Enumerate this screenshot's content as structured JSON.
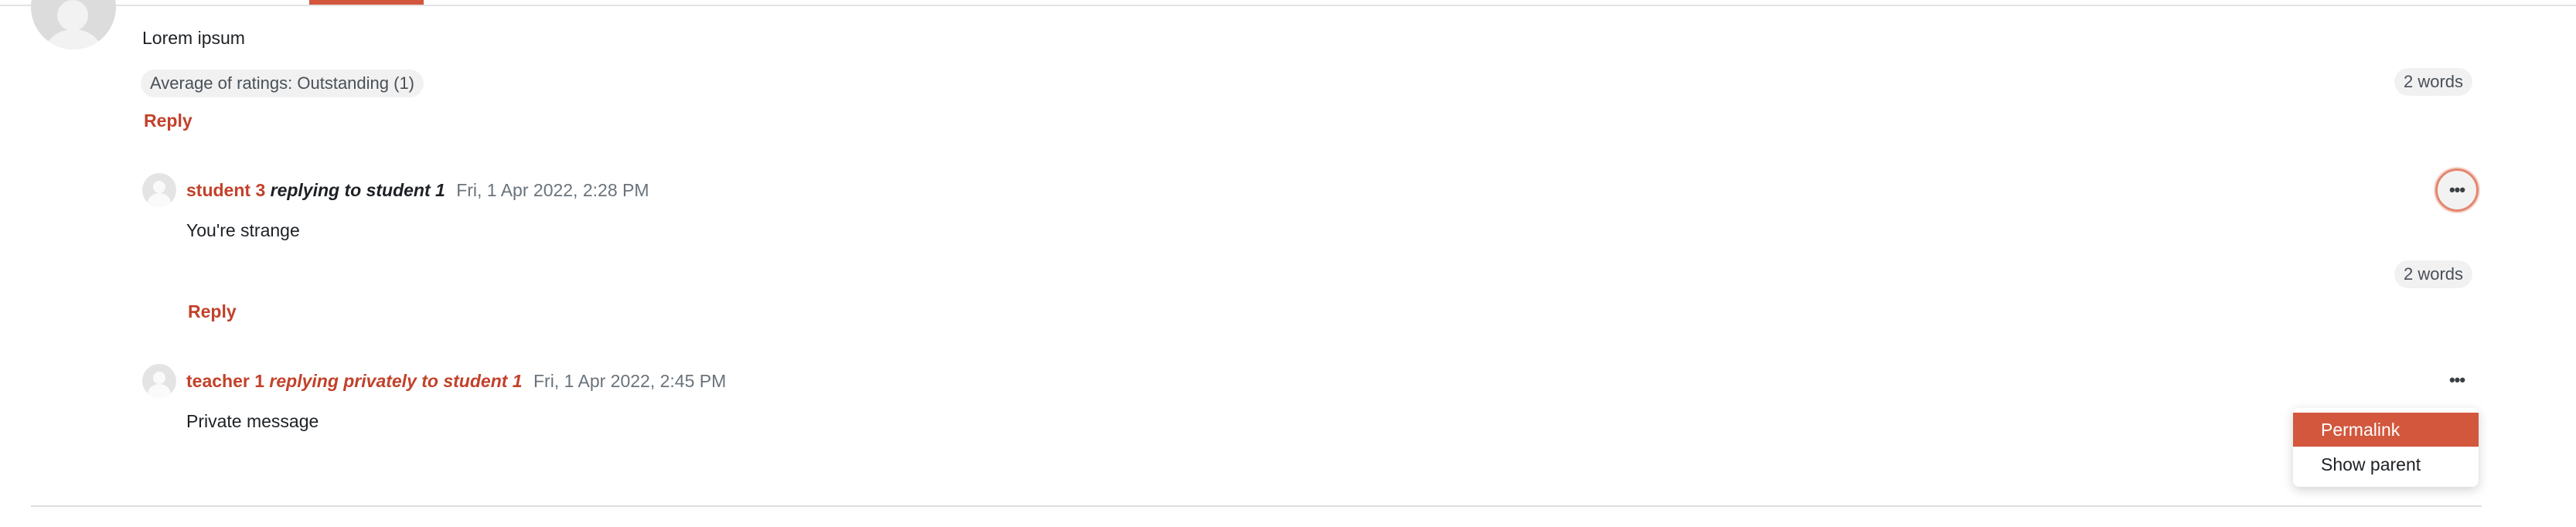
{
  "first_post": {
    "content": "Lorem ipsum",
    "rating": "Average of ratings: Outstanding (1)",
    "word_count": "2 words",
    "reply_label": "Reply"
  },
  "posts": [
    {
      "author": "student 3",
      "relation": "replying to student 1",
      "date": "Fri, 1 Apr 2022, 2:28 PM",
      "content": "You're strange",
      "word_count": "2 words",
      "reply_label": "Reply"
    },
    {
      "author": "teacher 1",
      "relation": "replying privately to student 1",
      "date": "Fri, 1 Apr 2022, 2:45 PM",
      "content": "Private message"
    }
  ],
  "more_icon": "ellipsis-icon",
  "menu": {
    "items": [
      "Permalink",
      "Show parent"
    ],
    "selected": "Permalink"
  },
  "colors": {
    "accent": "#d2573d",
    "link": "#c2412a"
  }
}
